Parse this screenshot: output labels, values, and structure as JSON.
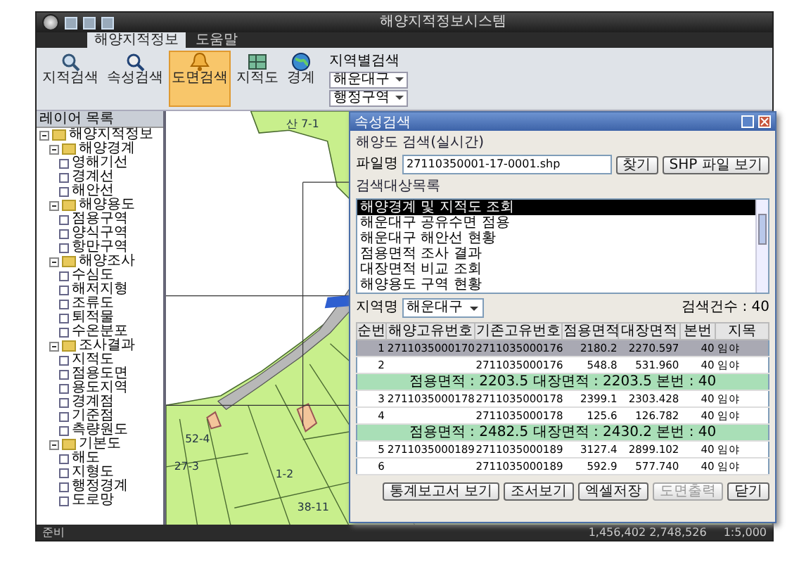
{
  "window": {
    "title": "해양지적정보시스템"
  },
  "ribbon": {
    "tabs": [
      {
        "label": "해양지적정보",
        "selected": true
      },
      {
        "label": "도움말",
        "selected": false
      }
    ],
    "tools": [
      {
        "label": "지적검색",
        "selected": false
      },
      {
        "label": "속성검색",
        "selected": false
      },
      {
        "label": "도면검색",
        "selected": true
      },
      {
        "label": "지적도",
        "selected": false
      },
      {
        "label": "경계",
        "selected": false
      }
    ],
    "region": {
      "label": "지역별검색",
      "district": "해운대구",
      "category": "행정구역"
    }
  },
  "tree": {
    "title": "레이어 목록",
    "items": [
      {
        "label": "해양지적정보",
        "expanded": true,
        "children": [
          {
            "label": "해양경계",
            "expanded": true,
            "children": [
              {
                "label": "영해기선",
                "checked": false
              },
              {
                "label": "경계선",
                "checked": false
              },
              {
                "label": "해안선",
                "checked": false
              }
            ]
          },
          {
            "label": "해양용도",
            "expanded": true,
            "children": [
              {
                "label": "점용구역",
                "checked": false
              },
              {
                "label": "양식구역",
                "checked": false
              },
              {
                "label": "항만구역",
                "checked": false
              }
            ]
          },
          {
            "label": "해양조사",
            "expanded": true,
            "children": [
              {
                "label": "수심도",
                "checked": false
              },
              {
                "label": "해저지형",
                "checked": false
              },
              {
                "label": "조류도",
                "checked": false
              },
              {
                "label": "퇴적물",
                "checked": false
              },
              {
                "label": "수온분포",
                "checked": false
              }
            ]
          },
          {
            "label": "조사결과",
            "expanded": true,
            "children": [
              {
                "label": "지적도",
                "checked": false
              },
              {
                "label": "점용도면",
                "checked": false
              },
              {
                "label": "용도지역",
                "checked": false
              },
              {
                "label": "경계점",
                "checked": false
              },
              {
                "label": "기준점",
                "checked": false
              },
              {
                "label": "측량원도",
                "checked": false
              }
            ]
          },
          {
            "label": "기본도",
            "expanded": true,
            "children": [
              {
                "label": "해도",
                "checked": false
              },
              {
                "label": "지형도",
                "checked": false
              },
              {
                "label": "행정경계",
                "checked": false
              },
              {
                "label": "도로망",
                "checked": false
              }
            ]
          }
        ]
      }
    ]
  },
  "map": {
    "labels": [
      "산 7-1",
      "27-3",
      "1-2",
      "38-11",
      "52-4"
    ]
  },
  "dialog": {
    "title": "속성검색",
    "file_section": "해양도 검색(실시간)",
    "file_label": "파일명",
    "file_value": "27110350001-17-0001.shp",
    "buttons_top": [
      "찾기",
      "SHP 파일 보기"
    ],
    "list_section": "검색대상목록",
    "list": [
      {
        "label": "해양경계 및 지적도 조회",
        "selected": true
      },
      {
        "label": "해운대구 공유수면 점용",
        "selected": false
      },
      {
        "label": "해운대구 해안선 현황",
        "selected": false
      },
      {
        "label": "점용면적 조사 결과",
        "selected": false
      },
      {
        "label": "대장면적 비교 조회",
        "selected": false
      },
      {
        "label": "해양용도 구역 현황",
        "selected": false
      }
    ],
    "filter_label": "지역명",
    "filter_value": "해운대구",
    "count": "검색건수 : 40",
    "columns": [
      "순번",
      "해양고유번호",
      "기존고유번호",
      "점용면적",
      "대장면적",
      "본번",
      "지목"
    ],
    "rows": [
      {
        "kind": "data",
        "selected": true,
        "cells": [
          "1",
          "2711035000170",
          "2711035000176",
          "2180.2",
          "2270.597",
          "40",
          "임야"
        ]
      },
      {
        "kind": "data",
        "selected": false,
        "cells": [
          "2",
          "",
          "2711035000176",
          "548.8",
          "531.960",
          "40",
          "임야"
        ]
      },
      {
        "kind": "summary",
        "selected": false,
        "text": "점용면적 : 2203.5   대장면적 : 2203.5   본번 : 40"
      },
      {
        "kind": "data",
        "selected": false,
        "cells": [
          "3",
          "2711035000178",
          "2711035000178",
          "2399.1",
          "2303.428",
          "40",
          "임야"
        ]
      },
      {
        "kind": "data",
        "selected": false,
        "cells": [
          "4",
          "",
          "2711035000178",
          "125.6",
          "126.782",
          "40",
          "임야"
        ]
      },
      {
        "kind": "summary",
        "selected": false,
        "text": "점용면적 : 2482.5   대장면적 : 2430.2   본번 : 40"
      },
      {
        "kind": "data",
        "selected": false,
        "cells": [
          "5",
          "2711035000189",
          "2711035000189",
          "3127.4",
          "2899.102",
          "40",
          "임야"
        ]
      },
      {
        "kind": "data",
        "selected": false,
        "cells": [
          "6",
          "",
          "2711035000189",
          "592.9",
          "577.740",
          "40",
          "임야"
        ]
      }
    ],
    "buttons": [
      {
        "label": "통계보고서 보기",
        "disabled": false
      },
      {
        "label": "조서보기",
        "disabled": false
      },
      {
        "label": "엑셀저장",
        "disabled": false
      },
      {
        "label": "도면출력",
        "disabled": true
      },
      {
        "label": "닫기",
        "disabled": false
      }
    ]
  },
  "status_bar": {
    "text": "준비",
    "coordinates": "1,456,402  2,748,526",
    "scale": "1:5,000"
  }
}
